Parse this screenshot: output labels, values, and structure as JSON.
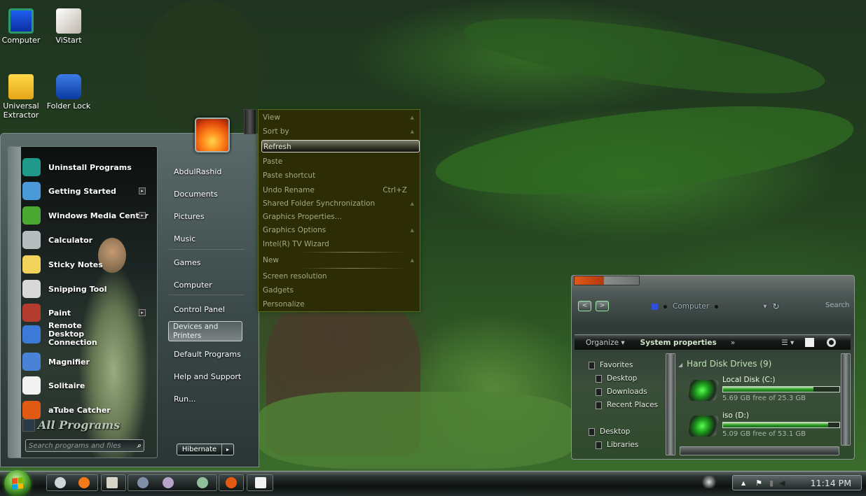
{
  "desktop": {
    "icons": [
      {
        "label": "Computer",
        "icon": "computer-icon"
      },
      {
        "label": "ViStart",
        "icon": "vistart-icon"
      },
      {
        "label": "Universal Extractor",
        "icon": "box-icon"
      },
      {
        "label": "Folder Lock",
        "icon": "key-icon"
      }
    ]
  },
  "start_menu": {
    "programs": [
      {
        "label": "Uninstall Programs",
        "icon": "uninstall-icon",
        "has_submenu": false
      },
      {
        "label": "Getting Started",
        "icon": "getting-started-icon",
        "has_submenu": true
      },
      {
        "label": "Windows Media Center",
        "icon": "media-center-icon",
        "has_submenu": true
      },
      {
        "label": "Calculator",
        "icon": "calculator-icon",
        "has_submenu": false
      },
      {
        "label": "Sticky Notes",
        "icon": "sticky-notes-icon",
        "has_submenu": false
      },
      {
        "label": "Snipping Tool",
        "icon": "snipping-tool-icon",
        "has_submenu": false
      },
      {
        "label": "Paint",
        "icon": "paint-icon",
        "has_submenu": true
      },
      {
        "label": "Remote Desktop Connection",
        "icon": "remote-desktop-icon",
        "has_submenu": false
      },
      {
        "label": "Magnifier",
        "icon": "magnifier-icon",
        "has_submenu": false
      },
      {
        "label": "Solitaire",
        "icon": "solitaire-icon",
        "has_submenu": false
      },
      {
        "label": "aTube Catcher",
        "icon": "atube-catcher-icon",
        "has_submenu": false
      }
    ],
    "all_programs": "All Programs",
    "search_placeholder": "Search programs and files",
    "right_items": [
      {
        "label": "AbdulRashid"
      },
      {
        "label": "Documents"
      },
      {
        "label": "Pictures"
      },
      {
        "label": "Music"
      },
      {
        "label": "Games"
      },
      {
        "label": "Computer"
      },
      {
        "label": "Control Panel"
      },
      {
        "label": "Devices and Printers"
      },
      {
        "label": "Default Programs"
      },
      {
        "label": "Help and Support"
      },
      {
        "label": "Run..."
      }
    ],
    "devices_line1": "Devices and",
    "devices_line2": "Printers",
    "power_button": "Hibernate",
    "power_arrow": "▸"
  },
  "context_menu": {
    "items": [
      {
        "label": "View",
        "shortcut": "",
        "submenu": true
      },
      {
        "label": "Sort by",
        "shortcut": "",
        "submenu": true
      },
      {
        "label": "Refresh",
        "shortcut": "",
        "submenu": false,
        "highlighted": true
      },
      {
        "label": "Paste",
        "shortcut": "",
        "submenu": false
      },
      {
        "label": "Paste shortcut",
        "shortcut": "",
        "submenu": false
      },
      {
        "label": "Undo Rename",
        "shortcut": "Ctrl+Z",
        "submenu": false
      },
      {
        "label": "Shared Folder Synchronization",
        "shortcut": "",
        "submenu": true
      },
      {
        "label": "Graphics Properties...",
        "shortcut": "",
        "submenu": false
      },
      {
        "label": "Graphics Options",
        "shortcut": "",
        "submenu": true
      },
      {
        "label": "Intel(R) TV Wizard",
        "shortcut": "",
        "submenu": false
      },
      {
        "label": "New",
        "shortcut": "",
        "submenu": true
      },
      {
        "label": "Screen resolution",
        "shortcut": "",
        "submenu": false
      },
      {
        "label": "Gadgets",
        "shortcut": "",
        "submenu": false
      },
      {
        "label": "Personalize",
        "shortcut": "",
        "submenu": false
      }
    ]
  },
  "explorer": {
    "back": "<",
    "forward": ">",
    "address": "Computer",
    "search_label": "Search",
    "toolbar": {
      "organize": "Organize ▾",
      "system_properties": "System properties",
      "more": "»"
    },
    "nav": [
      {
        "label": "Favorites",
        "indent": 0
      },
      {
        "label": "Desktop",
        "indent": 1
      },
      {
        "label": "Downloads",
        "indent": 1
      },
      {
        "label": "Recent Places",
        "indent": 1
      },
      {
        "label": "Desktop",
        "indent": 0
      },
      {
        "label": "Libraries",
        "indent": 1
      }
    ],
    "group_header": "Hard Disk Drives (9)",
    "drives": [
      {
        "name": "Local Disk (C:)",
        "free": "5.69 GB free of 25.3 GB",
        "used_fraction": 0.775
      },
      {
        "name": "iso (D:)",
        "free": "5.09 GB free of 53.1 GB",
        "used_fraction": 0.904
      }
    ]
  },
  "taskbar": {
    "pinned": [
      "weather-gadget-icon",
      "firefox-icon",
      "vistart-icon",
      "globe-icon",
      "media-player-icon",
      "remote-desktop-icon",
      "atube-catcher-icon",
      "notepad-icon"
    ],
    "tray_up": "▲",
    "clock": "11:14 PM"
  },
  "colors": {
    "context_bg": "#2c2c05",
    "context_text": "#a7a982",
    "drive_fill": "#2b9a22"
  }
}
